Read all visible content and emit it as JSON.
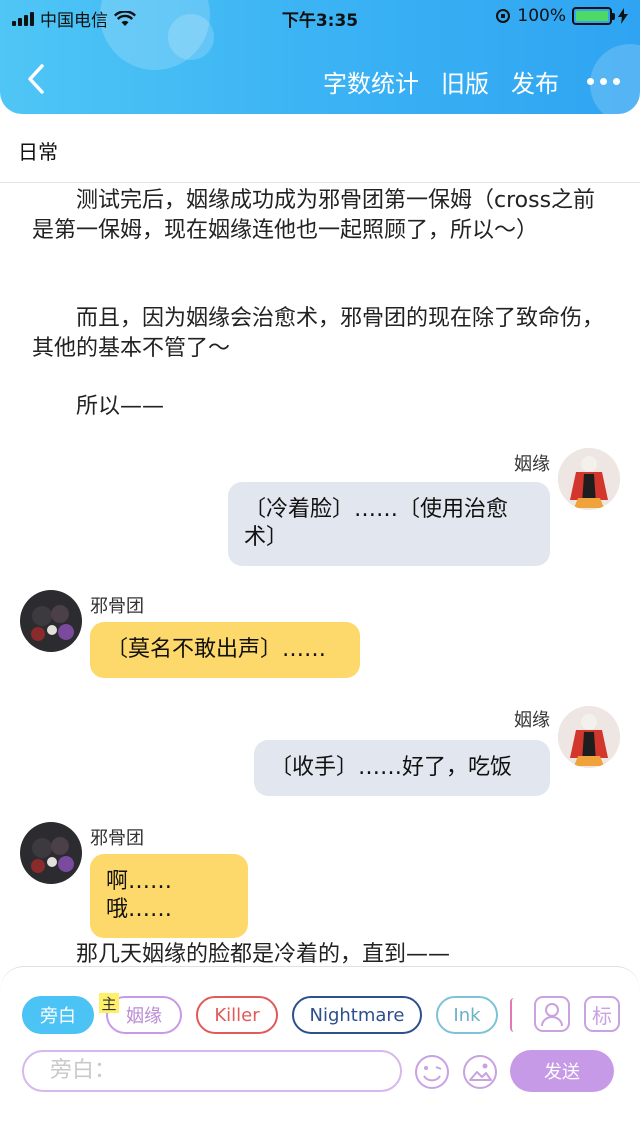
{
  "status_bar": {
    "carrier": "中国电信",
    "time": "下午3:35",
    "battery": "100%"
  },
  "nav": {
    "word_count": "字数统计",
    "old_version": "旧版",
    "publish": "发布"
  },
  "category": "日常",
  "content": {
    "para1": "测试完后，姻缘成功成为邪骨团第一保姆（cross之前是第一保姆，现在姻缘连他也一起照顾了，所以～）",
    "para2": "而且，因为姻缘会治愈术，邪骨团的现在除了致命伤，其他的基本不管了～",
    "para3": "所以——",
    "para4": "那几天姻缘的脸都是冷着的，直到——"
  },
  "messages": [
    {
      "name": "姻缘",
      "text": "〔冷着脸〕……〔使用治愈术〕"
    },
    {
      "name": "邪骨团",
      "text": "〔莫名不敢出声〕……"
    },
    {
      "name": "姻缘",
      "text": "〔收手〕……好了，吃饭"
    },
    {
      "name": "邪骨团",
      "text": "啊……哦……"
    }
  ],
  "bottom": {
    "roles": [
      "旁白",
      "姻缘",
      "Killer",
      "Nightmare",
      "Ink"
    ],
    "main_mark": "主",
    "label_icon_text": "标",
    "input_placeholder": "旁白：",
    "send": "发送"
  },
  "colors": {
    "header": "#3bb3f4",
    "grey_bubble": "#e2e7ef",
    "yellow_bubble": "#fdd86b",
    "accent_purple": "#c79ae8"
  }
}
